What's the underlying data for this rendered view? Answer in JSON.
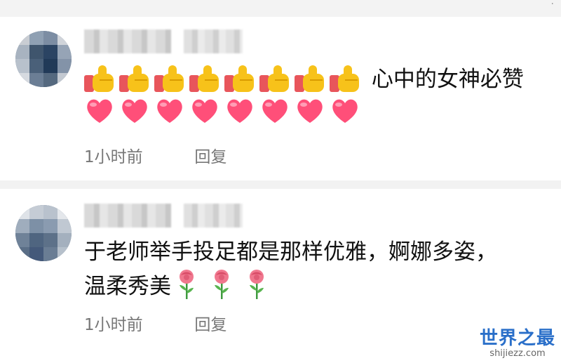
{
  "corner_mark": "·",
  "comments": [
    {
      "content_text": "心中的女神必赞",
      "emojis": {
        "thumbs_up_count": 8,
        "heart_count": 8,
        "heart_color": "#ff4f79"
      },
      "time": "1小时前",
      "reply_label": "回复"
    },
    {
      "content_text": "于老师举手投足都是那样优雅，婀娜多姿，温柔秀美",
      "emojis": {
        "rose_count": 3
      },
      "time": "1小时前",
      "reply_label": "回复"
    }
  ],
  "watermark": {
    "title": "世界之最",
    "subtitle": "shijiezz.com"
  },
  "colors": {
    "meta_text": "#777777",
    "divider": "#f2f2f2",
    "watermark": "#2a6fc9"
  }
}
